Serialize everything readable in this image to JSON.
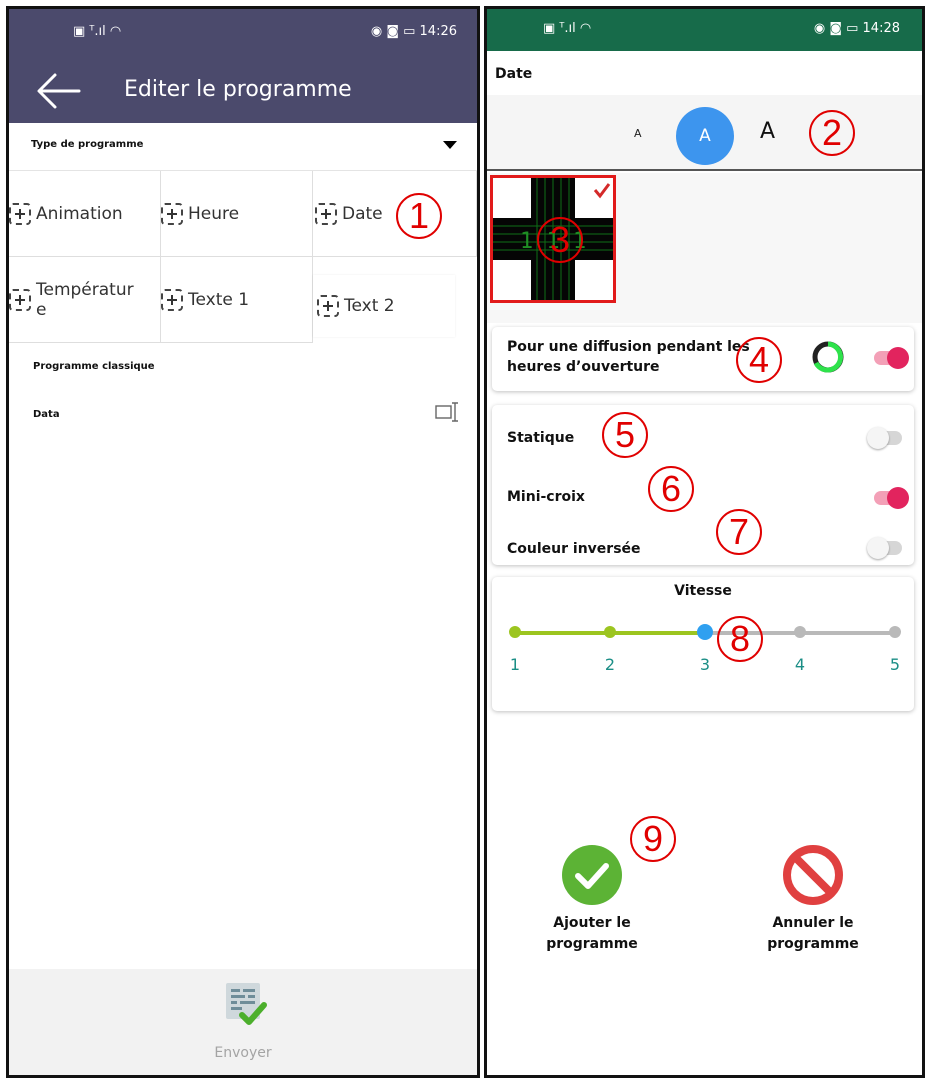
{
  "left_screen": {
    "status_left": "▣ ᵀ.ıl ◠",
    "status_right": "◉ ◙ ▭ 14:26",
    "title": "Editer le programme",
    "type_label": "Type de programme",
    "program_types": [
      "Animation",
      "Heure",
      "Date",
      "Températur e",
      "Texte 1",
      "Text 2"
    ],
    "classic_title": "Programme classique",
    "data_label": "Data",
    "send_label": "Envoyer",
    "colors": {
      "appbar": "#4b4a6c"
    }
  },
  "right_screen": {
    "status_left": "▣ ᵀ.ıl ◠",
    "status_right": "◉ ◙ ▭ 14:28",
    "title": "Date",
    "font_sizes": [
      "A",
      "A",
      "A"
    ],
    "selected_font_size": 2,
    "preview_digits": "1   1 1",
    "opening_hours_label": "Pour une diffusion pendant les heures d’ouverture",
    "opening_hours_on": true,
    "options": [
      {
        "label": "Statique",
        "on": false
      },
      {
        "label": "Mini-croix",
        "on": true
      },
      {
        "label": "Couleur inversée",
        "on": false
      }
    ],
    "speed_title": "Vitesse",
    "speed_ticks": [
      "1",
      "2",
      "3",
      "4",
      "5"
    ],
    "speed_value": 3,
    "add_label_1": "Ajouter le",
    "add_label_2": "programme",
    "cancel_label_1": "Annuler le",
    "cancel_label_2": "programme",
    "colors": {
      "status": "#176b4a",
      "accent": "#3d95ee",
      "toggle_on": "#e2245e",
      "slider": "#9cc520"
    }
  },
  "callouts": [
    "1",
    "2",
    "3",
    "4",
    "5",
    "6",
    "7",
    "8",
    "9"
  ]
}
